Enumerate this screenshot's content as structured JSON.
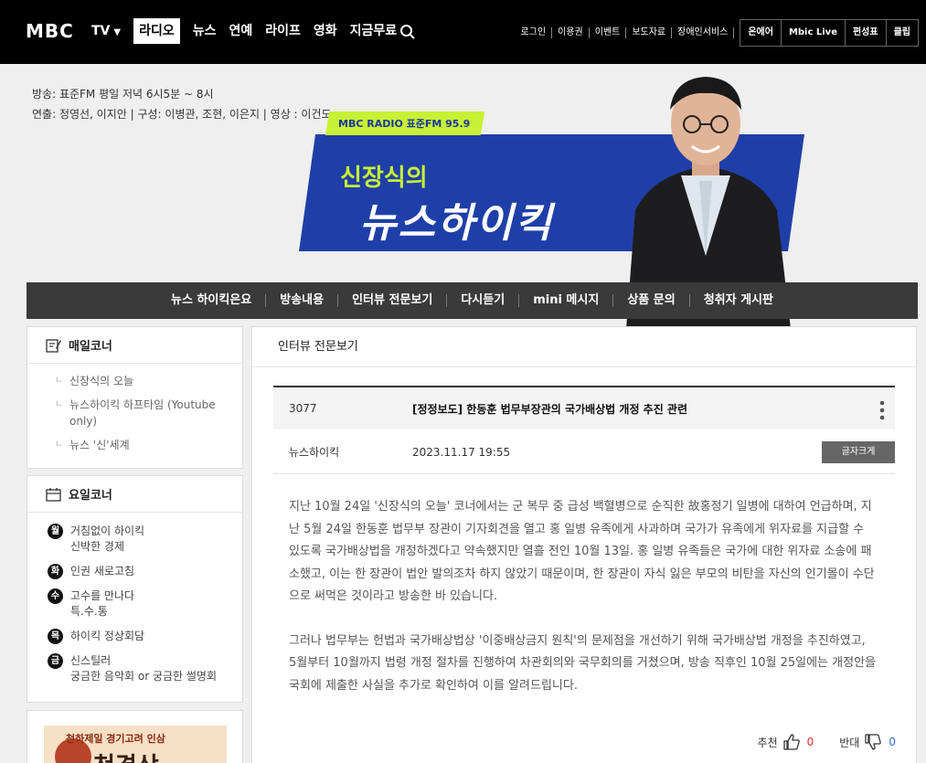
{
  "header": {
    "logo": "MBC",
    "nav": [
      {
        "label": "TV",
        "has_caret": true,
        "caret": "▼"
      },
      {
        "label": "라디오",
        "active": true
      },
      {
        "label": "뉴스"
      },
      {
        "label": "연예"
      },
      {
        "label": "라이프"
      },
      {
        "label": "영화"
      },
      {
        "label": "지금무료"
      }
    ],
    "util_links": [
      "로그인",
      "이용권",
      "이벤트",
      "보도자료",
      "장애인서비스"
    ],
    "util_boxes": [
      "온에어",
      "Mbic Live",
      "편성표",
      "클립"
    ]
  },
  "program": {
    "broadcast_line": "방송: 표준FM 평일 저녁 6시5분 ~ 8시",
    "staff_line": "연출: 정영선, 이지안 | 구성: 이병관, 조현, 이은지 | 영상 : 이건도",
    "badge": "MBC RADIO 표준FM 95.9",
    "title_small": "신장식의",
    "title_big": "뉴스하이킥"
  },
  "subnav": [
    "뉴스 하이킥은요",
    "방송내용",
    "인터뷰 전문보기",
    "다시듣기",
    "mini 메시지",
    "상품 문의",
    "청취자 게시판"
  ],
  "sidebar": {
    "daily": {
      "title": "매일코너",
      "items": [
        "신장식의 오늘",
        "뉴스하이킥 하프타임 (Youtube only)",
        "뉴스 '신'세계"
      ]
    },
    "weekly": {
      "title": "요일코너",
      "items": [
        {
          "day": "월",
          "lines": [
            "거침없이 하이킥",
            "신박한 경제"
          ]
        },
        {
          "day": "화",
          "lines": [
            "인권 새로고침"
          ]
        },
        {
          "day": "수",
          "lines": [
            "고수를 만나다",
            "특.수.통"
          ]
        },
        {
          "day": "목",
          "lines": [
            "하이킥 정상회담"
          ]
        },
        {
          "day": "금",
          "lines": [
            "신스틸러",
            "궁금한 음악회 or 궁금한 썰명회"
          ]
        }
      ]
    },
    "promo": {
      "line1": "천하제일 경기고려 인삼",
      "line2": "천경상"
    }
  },
  "main": {
    "section_title": "인터뷰 전문보기",
    "article": {
      "number": "3077",
      "title": "[정정보도] 한동훈 법무부장관의 국가배상법 개정 추진 관련",
      "author": "뉴스하이킥",
      "date": "2023.11.17 19:55",
      "font_button": "글자크게",
      "paragraphs": [
        "지난 10월 24일 '신장식의 오늘' 코너에서는 군 복무 중 급성 백혈병으로 순직한 故홍정기 일병에 대하여 언급하며, 지난 5월 24일 한동훈 법무부 장관이 기자회견을 열고 홍 일병 유족에게 사과하며 국가가 유족에게 위자료를 지급할 수 있도록 국가배상법을 개정하겠다고 약속했지만 열흘 전인 10월 13일. 홍 일병 유족들은 국가에 대한 위자료 소송에 패소했고, 이는 한 장관이 법안 발의조차 하지 않았기 때문이며, 한 장관이 자식 잃은 부모의 비탄을 자신의 인기몰이 수단으로 써먹은 것이라고 방송한 바 있습니다.",
        "그러나 법무부는 헌법과 국가배상법상 '이중배상금지 원칙'의 문제점을 개선하기 위해 국가배상법 개정을 추진하였고, 5월부터 10월까지 법령 개정 절차를 진행하여 차관회의와 국무회의를 거쳤으며, 방송 직후인 10월 25일에는 개정안을 국회에 제출한 사실을 추가로 확인하여 이를 알려드립니다."
      ],
      "like_label": "추천",
      "like_count": "0",
      "dislike_label": "반대",
      "dislike_count": "0"
    }
  }
}
